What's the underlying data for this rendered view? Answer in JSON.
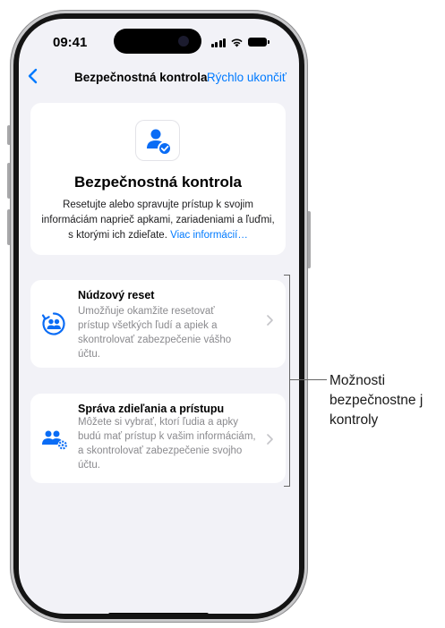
{
  "status": {
    "time": "09:41"
  },
  "nav": {
    "back_icon": "chevron-left-icon",
    "title": "Bezpečnostná kontrola",
    "quit": "Rýchlo ukončiť"
  },
  "header": {
    "icon": "person-checkmark-icon",
    "title": "Bezpečnostná kontrola",
    "description": "Resetujte alebo spravujte prístup k svojim informáciám naprieč apkami, zariadeniami a ľuďmi, s ktorými ich zdieľate.",
    "link": "Viac informácií…"
  },
  "options": [
    {
      "icon": "emergency-reset-icon",
      "title": "Núdzový reset",
      "description": "Umožňuje okamžite resetovať prístup všetkých ľudí a apiek a skontrolovať zabezpečenie vášho účtu."
    },
    {
      "icon": "sharing-access-icon",
      "title": "Správa zdieľania a prístupu",
      "description": "Môžete si vybrať, ktorí ľudia a apky budú mať prístup k vašim informáciám, a skontrolovať zabezpečenie svojho účtu."
    }
  ],
  "callout": {
    "label": "Možnosti bezpečnostne j kontroly"
  },
  "colors": {
    "accent": "#007aff",
    "background": "#f2f2f7"
  }
}
